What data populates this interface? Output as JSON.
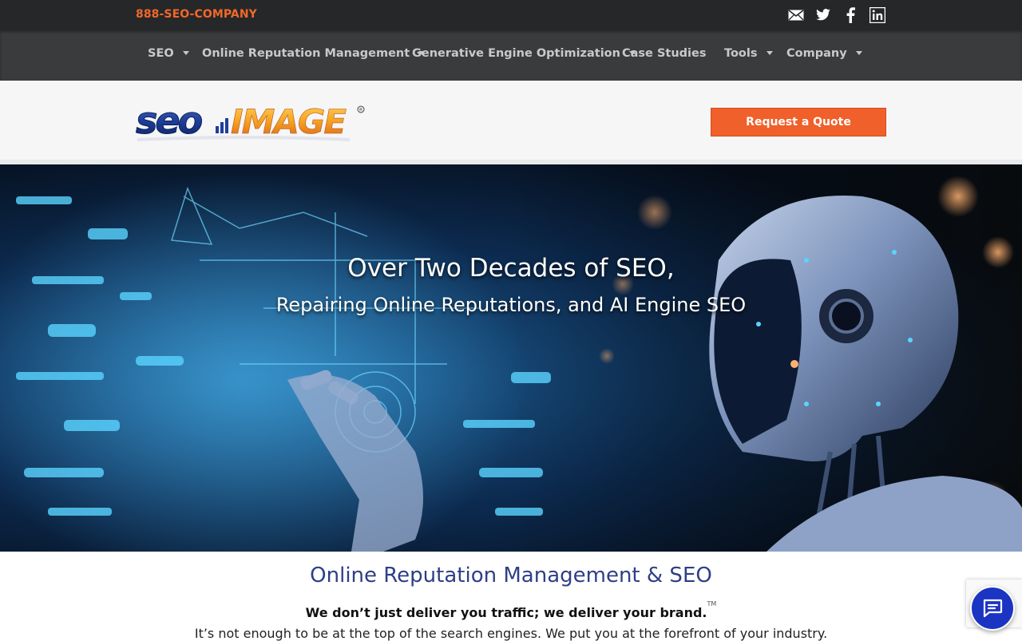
{
  "topbar": {
    "phone": "888-SEO-COMPANY",
    "socials": [
      {
        "icon": "email-icon"
      },
      {
        "icon": "twitter-icon"
      },
      {
        "icon": "facebook-icon"
      },
      {
        "icon": "linkedin-icon"
      }
    ]
  },
  "nav": {
    "items": [
      {
        "label": "SEO",
        "has_dropdown": true
      },
      {
        "label": "Online Reputation Management",
        "has_dropdown": true
      },
      {
        "label": "Generative Engine Optimization",
        "has_dropdown": true
      },
      {
        "label": "Case Studies",
        "has_dropdown": false
      },
      {
        "label": "Tools",
        "has_dropdown": true
      },
      {
        "label": "Company",
        "has_dropdown": true
      }
    ]
  },
  "header": {
    "logo_text": "seo IMAGE",
    "quote_button": "Request a Quote"
  },
  "hero": {
    "title": "Over Two Decades of SEO,",
    "subtitle": "Repairing Online Reputations, and AI Engine SEO"
  },
  "content": {
    "section_title": "Online Reputation Management & SEO",
    "tagline": "We don’t just deliver you traffic; we deliver your brand.",
    "tagline_mark": "TM",
    "body": "It’s not enough to be at the top of the search engines. We put you at the forefront of your industry."
  },
  "colors": {
    "accent": "#f0602a",
    "phone": "#f0682a",
    "topbar": "#262729",
    "navbar": "#3a3b3d",
    "title_blue": "#2e3f86",
    "chat": "#1c34c2"
  },
  "widgets": {
    "chat_icon": "chat-icon",
    "recaptcha_icon": "recaptcha-icon"
  }
}
